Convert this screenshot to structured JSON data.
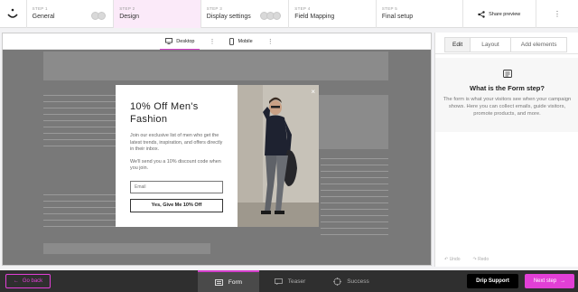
{
  "steps": [
    {
      "num": "STEP 1",
      "label": "General"
    },
    {
      "num": "STEP 2",
      "label": "Design"
    },
    {
      "num": "STEP 3",
      "label": "Display settings"
    },
    {
      "num": "STEP 4",
      "label": "Field Mapping"
    },
    {
      "num": "STEP 5",
      "label": "Final setup"
    }
  ],
  "share_label": "Share preview",
  "devices": {
    "desktop": "Desktop",
    "mobile": "Mobile"
  },
  "popup": {
    "title": "10% Off Men's Fashion",
    "body": "Join our exclusive list of men who get the latest trends, inspiration, and offers directly in their inbox.",
    "body2": "We'll send you a 10% discount code when you join.",
    "email_placeholder": "Email",
    "cta": "Yes, Give Me 10% Off",
    "close": "×"
  },
  "panel": {
    "tabs": [
      "Edit",
      "Layout",
      "Add elements"
    ],
    "help_title": "What is the Form step?",
    "help_text": "The form is what your visitors see when your campaign shows. Here you can collect emails, guide visitors, promote products, and more.",
    "undo": "Undo",
    "redo": "Redo"
  },
  "bottom": {
    "go_back": "Go back",
    "tabs": [
      "Form",
      "Teaser",
      "Success"
    ],
    "drip": "Drip Support",
    "next": "Next step"
  },
  "colors": {
    "accent": "#e23fd6",
    "active_step_bg": "#fbeaf9"
  },
  "icons": [
    "logo-icon",
    "toggle-icon",
    "share-icon",
    "desktop-icon",
    "mobile-icon",
    "kebab-icon",
    "help-doc-icon",
    "undo-icon",
    "redo-icon",
    "arrow-left-icon",
    "arrow-right-icon",
    "form-icon",
    "teaser-icon",
    "success-icon"
  ]
}
